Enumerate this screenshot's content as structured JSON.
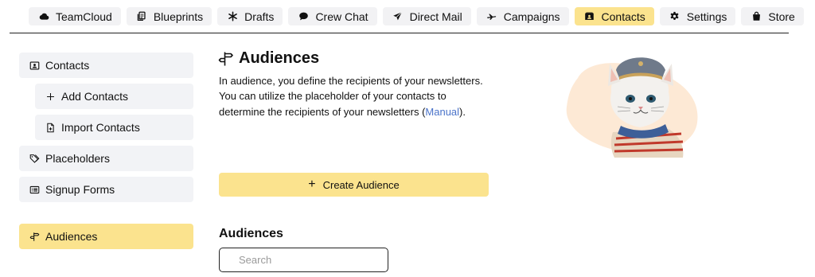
{
  "nav": {
    "tabs": [
      {
        "label": "TeamCloud",
        "icon": "cloud-icon",
        "active": false
      },
      {
        "label": "Blueprints",
        "icon": "copy-icon",
        "active": false
      },
      {
        "label": "Drafts",
        "icon": "asterisk-icon",
        "active": false
      },
      {
        "label": "Crew Chat",
        "icon": "chat-bubble-icon",
        "active": false
      },
      {
        "label": "Direct Mail",
        "icon": "send-icon",
        "active": false
      },
      {
        "label": "Campaigns",
        "icon": "plane-icon",
        "active": false
      },
      {
        "label": "Contacts",
        "icon": "contact-card-icon",
        "active": true
      },
      {
        "label": "Settings",
        "icon": "gear-icon",
        "active": false
      },
      {
        "label": "Store",
        "icon": "shopping-bag-icon",
        "active": false
      }
    ]
  },
  "sidebar": {
    "items": [
      {
        "label": "Contacts",
        "icon": "contact-card-icon",
        "active": false
      },
      {
        "label": "Add Contacts",
        "icon": "plus-icon",
        "active": false
      },
      {
        "label": "Import Contacts",
        "icon": "file-plus-icon",
        "active": false
      },
      {
        "label": "Placeholders",
        "icon": "tags-icon",
        "active": false
      },
      {
        "label": "Signup Forms",
        "icon": "form-list-icon",
        "active": false
      },
      {
        "label": "Audiences",
        "icon": "signpost-icon",
        "active": true
      }
    ]
  },
  "main": {
    "title": "Audiences",
    "title_icon": "signpost-icon",
    "description": "In audience, you define the recipients of your newsletters. You can utilize the placeholder of your contacts to determine the recipients of your newsletters (",
    "description_link": "Manual",
    "description_end": ").",
    "create_button": "Create Audience",
    "section_title": "Audiences",
    "search_placeholder": "Search"
  },
  "mascot": {
    "icon": "cat-mascot-illustration"
  },
  "colors": {
    "accent": "#fbe38e",
    "tab_bg": "#f2f2f4",
    "link": "#4a73c9"
  }
}
